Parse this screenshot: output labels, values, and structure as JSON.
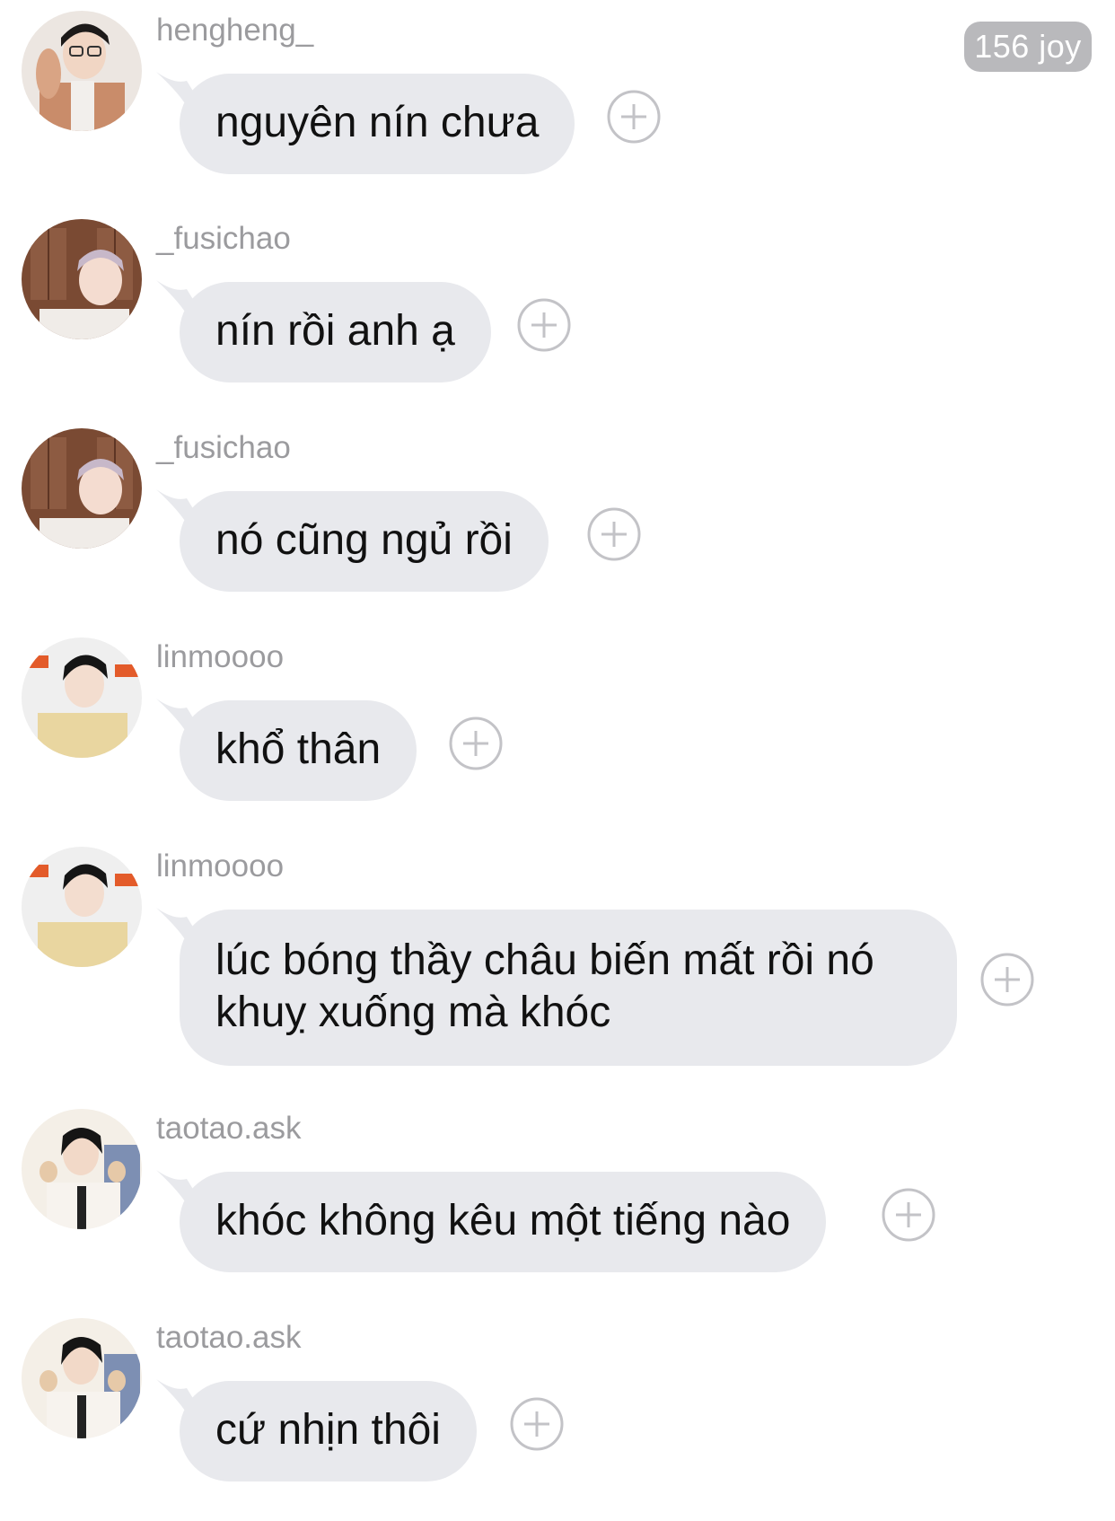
{
  "badge": {
    "label": "156 joy"
  },
  "messages": [
    {
      "username": "hengheng_",
      "text": "nguyên nín chưa",
      "avatar": "avatar-hengheng"
    },
    {
      "username": "_fusichao",
      "text": "nín rồi anh ạ",
      "avatar": "avatar-fusichao"
    },
    {
      "username": "_fusichao",
      "text": "nó cũng ngủ rồi",
      "avatar": "avatar-fusichao"
    },
    {
      "username": "linmoooo",
      "text": "khổ thân",
      "avatar": "avatar-linmoooo"
    },
    {
      "username": "linmoooo",
      "text": "lúc bóng thầy châu biến mất rồi nó khuỵ xuống mà khóc",
      "avatar": "avatar-linmoooo"
    },
    {
      "username": "taotao.ask",
      "text": "khóc không kêu một tiếng nào",
      "avatar": "avatar-taotao"
    },
    {
      "username": "taotao.ask",
      "text": "cứ nhịn thôi",
      "avatar": "avatar-taotao"
    }
  ],
  "icons": {
    "add": "plus-circle-icon"
  },
  "colors": {
    "bubble": "#e8e9ed",
    "username": "#9b9b9e",
    "badge": "#b9b9bc",
    "add_icon": "#c3c3c7"
  }
}
